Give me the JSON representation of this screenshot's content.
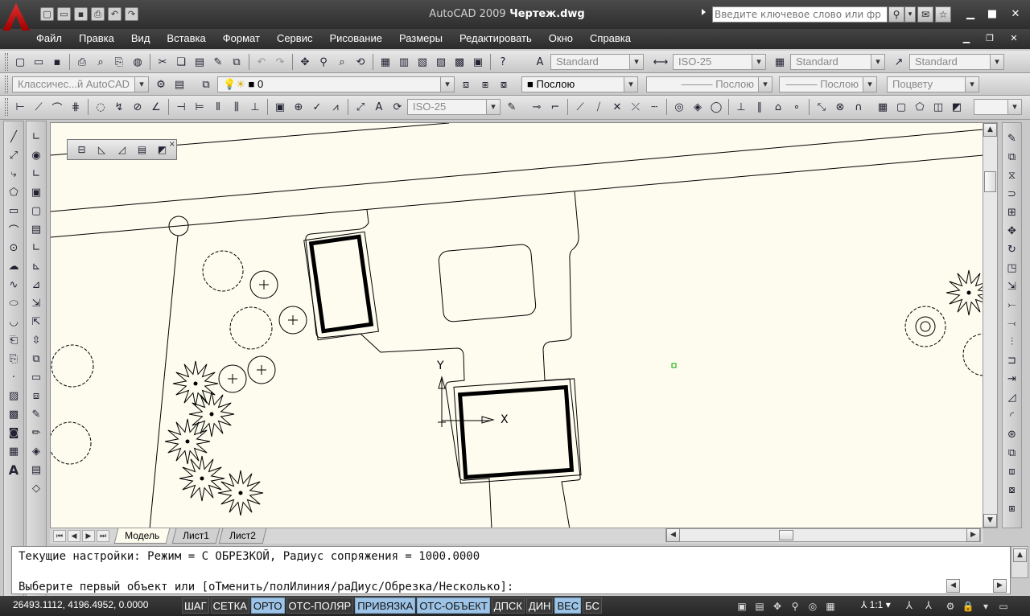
{
  "titlebar": {
    "app_name": "AutoCAD 2009",
    "document_name": "Чертеж.dwg",
    "search_placeholder": "Введите ключевое слово или фр",
    "buttons": [
      "search-icon",
      "chevron-down-icon",
      "info-icon",
      "star-icon"
    ]
  },
  "quick_access": {
    "icons": [
      "new-file-icon",
      "open-file-icon",
      "save-icon",
      "print-icon",
      "undo-icon",
      "redo-icon"
    ]
  },
  "menu": {
    "items": [
      "Файл",
      "Правка",
      "Вид",
      "Вставка",
      "Формат",
      "Сервис",
      "Рисование",
      "Размеры",
      "Редактировать",
      "Окно",
      "Справка"
    ]
  },
  "toolbars": {
    "text_style": "Standard",
    "dim_style": "ISO-25",
    "table_style": "Standard",
    "multileader_style": "Standard",
    "workspace": "Классичес...й AutoCAD",
    "layer": "0",
    "color": "Послою",
    "linetype": "Послою",
    "lineweight": "Послою",
    "plotstyle": "Поцвету",
    "dim_style_2": "ISO-25"
  },
  "drawing": {
    "ucs_x_label": "X",
    "ucs_y_label": "Y",
    "background_color": "#fdfcee",
    "line_color": "#000000",
    "snap_marker_color": "#00aa00"
  },
  "layout_tabs": [
    "Модель",
    "Лист1",
    "Лист2"
  ],
  "active_layout": "Модель",
  "command": {
    "history_line": "Текущие настройки: Режим = С ОБРЕЗКОЙ, Радиус сопряжения = 1000.0000",
    "prompt_line": "Выберите первый объект или [оТменить/полИлиния/раДиус/Обрезка/Несколько]:"
  },
  "status": {
    "coordinates": "26493.1112, 4196.4952, 0.0000",
    "toggles": [
      {
        "label": "ШАГ",
        "on": false
      },
      {
        "label": "СЕТКА",
        "on": false
      },
      {
        "label": "ОРТО",
        "on": true
      },
      {
        "label": "ОТС-ПОЛЯР",
        "on": false
      },
      {
        "label": "ПРИВЯЗКА",
        "on": true
      },
      {
        "label": "ОТС-ОБЪЕКТ",
        "on": true
      },
      {
        "label": "ДПСК",
        "on": false
      },
      {
        "label": "ДИН",
        "on": false
      },
      {
        "label": "ВЕС",
        "on": true
      },
      {
        "label": "БС",
        "on": false
      }
    ],
    "annotation_scale": "1:1"
  },
  "colors": {
    "titlebar_bg": "#353535",
    "toggle_on": "#9dc3e6",
    "canvas_bg": "#fdfcee"
  }
}
